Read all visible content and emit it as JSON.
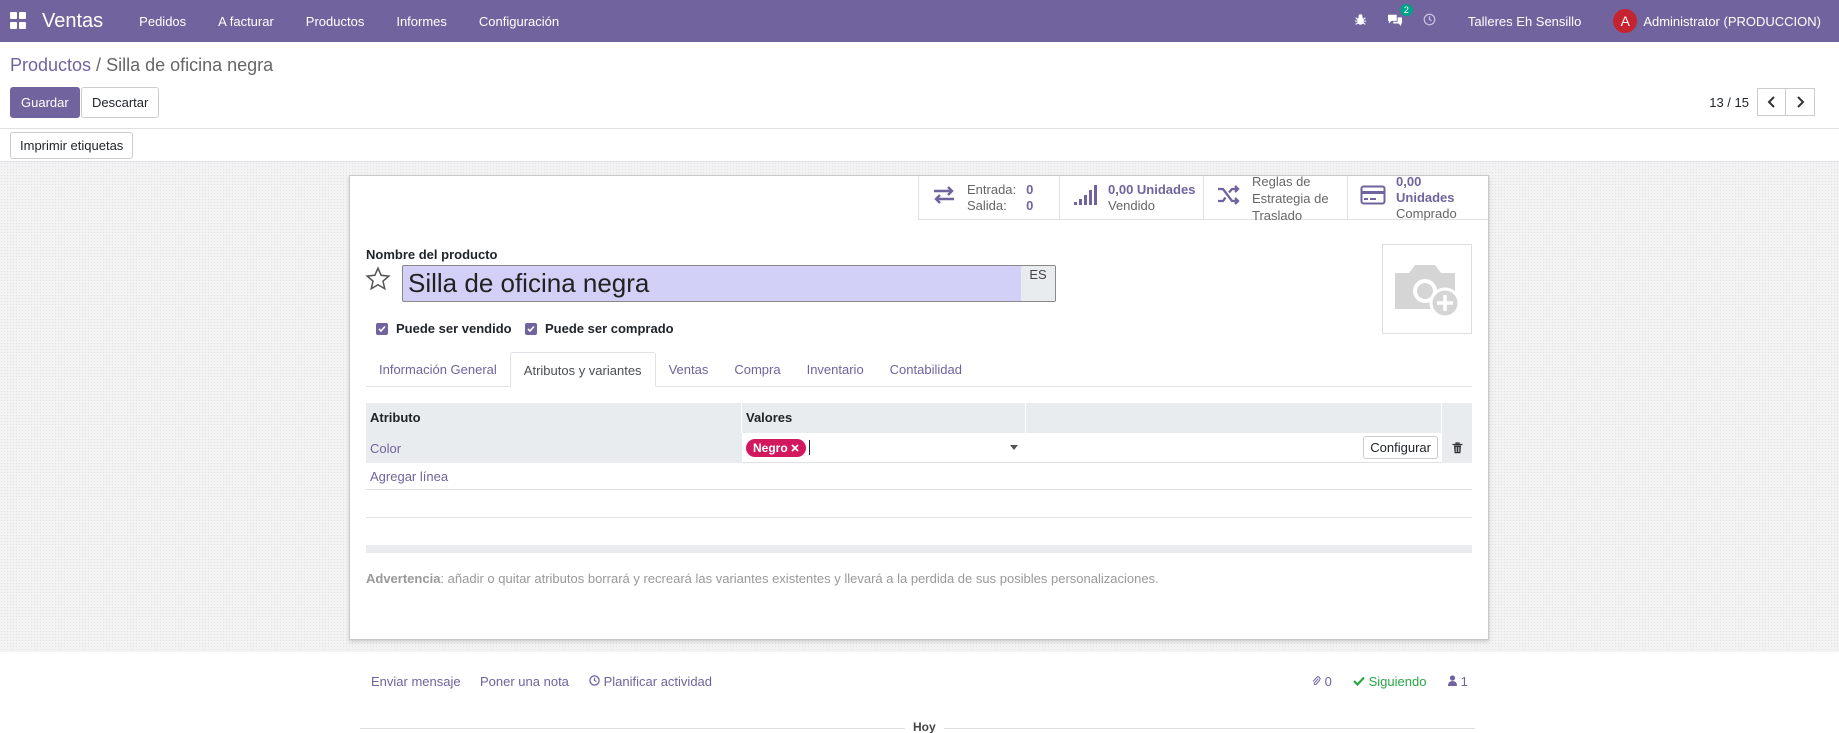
{
  "navbar": {
    "brand": "Ventas",
    "menu": [
      "Pedidos",
      "A facturar",
      "Productos",
      "Informes",
      "Configuración"
    ],
    "message_count": "2",
    "company": "Talleres Eh Sensillo",
    "avatar_letter": "A",
    "user": "Administrator (PRODUCCION)"
  },
  "breadcrumb": {
    "parent": "Productos",
    "separator": " / ",
    "current": "Silla de oficina negra"
  },
  "actions": {
    "save": "Guardar",
    "discard": "Descartar",
    "print_labels": "Imprimir etiquetas"
  },
  "pager": {
    "value": "13 / 15"
  },
  "smart_buttons": {
    "moves": {
      "in_label": "Entrada:",
      "in_value": "0",
      "out_label": "Salida:",
      "out_value": "0"
    },
    "sold": {
      "value": "0,00 Unidades",
      "label": "Vendido"
    },
    "routes": {
      "label": "Reglas de Estrategia de Traslado"
    },
    "purchased": {
      "value": "0,00 Unidades",
      "label": "Comprado"
    }
  },
  "form": {
    "name_label": "Nombre del producto",
    "name_value": "Silla de oficina negra",
    "lang": "ES",
    "can_sell_label": "Puede ser vendido",
    "can_purchase_label": "Puede ser comprado"
  },
  "tabs": [
    {
      "label": "Información General",
      "active": false
    },
    {
      "label": "Atributos y variantes",
      "active": true
    },
    {
      "label": "Ventas",
      "active": false
    },
    {
      "label": "Compra",
      "active": false
    },
    {
      "label": "Inventario",
      "active": false
    },
    {
      "label": "Contabilidad",
      "active": false
    }
  ],
  "attributes_table": {
    "headers": [
      "Atributo",
      "Valores"
    ],
    "rows": [
      {
        "attribute": "Color",
        "values": [
          "Negro"
        ],
        "action": "Configurar"
      }
    ],
    "add_line": "Agregar línea"
  },
  "warning": {
    "title": "Advertencia",
    "text": ": añadir o quitar atributos borrará y recreará las variantes existentes y llevará a la perdida de sus posibles personalizaciones."
  },
  "chatter": {
    "send_message": "Enviar mensaje",
    "log_note": "Poner una nota",
    "schedule_activity": "Planificar actividad",
    "attachments": "0",
    "following": "Siguiendo",
    "followers": "1",
    "today": "Hoy"
  },
  "colors": {
    "primary": "#71639e",
    "tag": "#d2185f",
    "following": "#28a745"
  }
}
